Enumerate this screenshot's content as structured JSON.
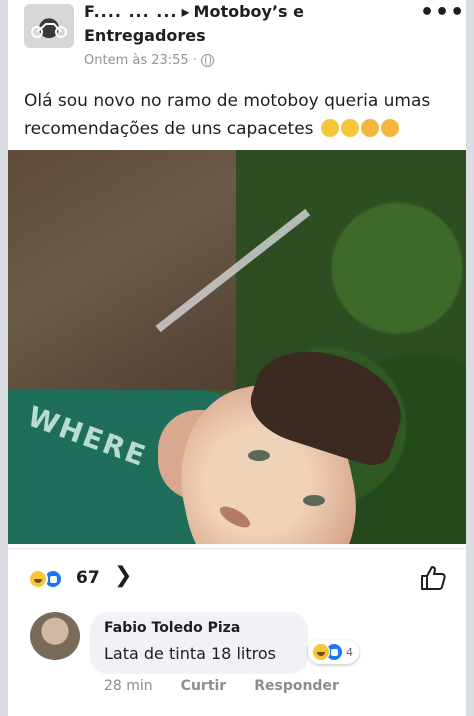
{
  "post": {
    "author": "F.... ... ...",
    "group": "Motoboy’s e",
    "group_line2": "Entregadores",
    "time": "Ontem às 23:55 ·",
    "text": "Olá sou novo no ramo de motoboy queria umas recomendações de uns capacetes",
    "more": "•••",
    "emoji_icons": [
      "clap-emoji",
      "clap-emoji",
      "ok-hand-emoji",
      "ok-hand-emoji"
    ]
  },
  "photo": {
    "shirt_text": "WHERE YO DE YO"
  },
  "reactions": {
    "count": "67",
    "chevron": "❯",
    "icons": [
      "haha-icon",
      "like-icon"
    ]
  },
  "comment": {
    "author": "Fabio Toledo Piza",
    "text": "Lata de tinta 18 litros",
    "reaction_count": "4",
    "time": "28 min",
    "like": "Curtir",
    "reply": "Responder"
  },
  "colors": {
    "like_blue": "#1877f2",
    "haha_yellow": "#f7c53a",
    "muted_text": "#90949c",
    "bubble": "#f0f2f5"
  }
}
